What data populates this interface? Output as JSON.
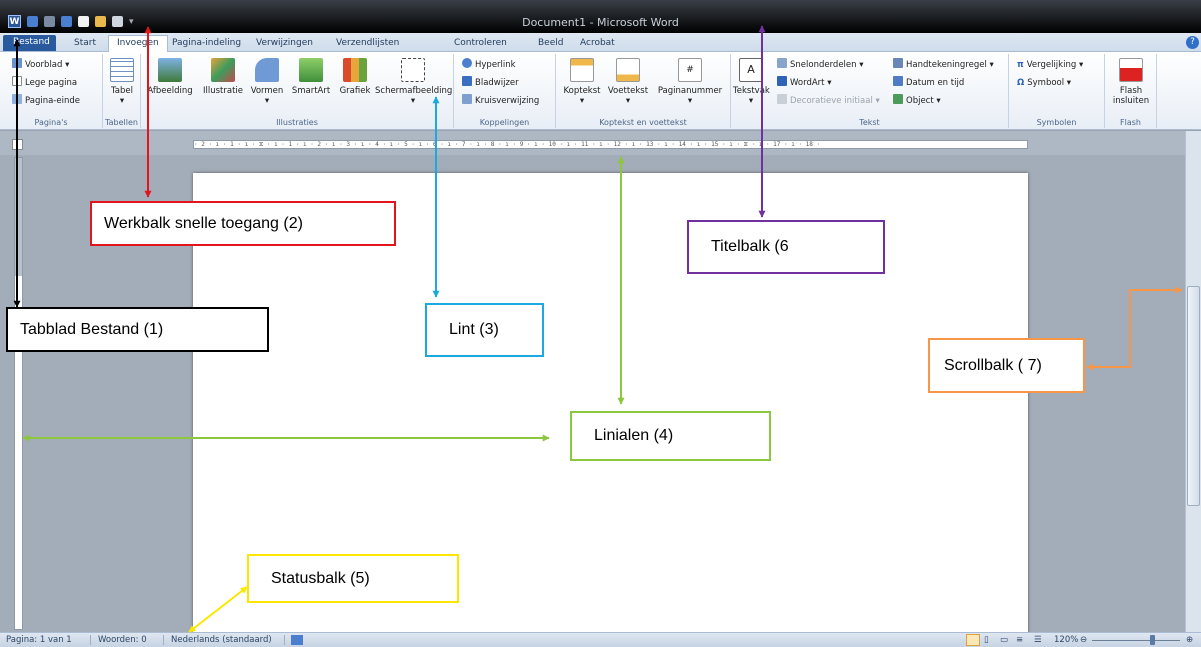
{
  "titlebar": {
    "document_title": "Document1 - Microsoft Word"
  },
  "quick_access": {
    "icons": [
      "word-logo",
      "save-icon",
      "undo-icon",
      "redo-icon",
      "new-doc-icon",
      "open-icon",
      "print-icon"
    ]
  },
  "tabs": {
    "file": "Bestand",
    "items": [
      "Start",
      "Invoegen",
      "Pagina-indeling",
      "Verwijzingen",
      "Verzendlijsten",
      "Controleren",
      "Beeld",
      "Acrobat"
    ],
    "active": "Invoegen"
  },
  "ribbon": {
    "paginas": {
      "label": "Pagina's",
      "items": [
        "Voorblad",
        "Lege pagina",
        "Pagina-einde"
      ]
    },
    "tabellen": {
      "label": "Tabellen",
      "button": "Tabel"
    },
    "illustraties": {
      "label": "Illustraties",
      "buttons": [
        "Afbeelding",
        "Illustratie",
        "Vormen",
        "SmartArt",
        "Grafiek",
        "Schermafbeelding"
      ]
    },
    "koppelingen": {
      "label": "Koppelingen",
      "items": [
        "Hyperlink",
        "Bladwijzer",
        "Kruisverwijzing"
      ]
    },
    "koptekst": {
      "label": "Koptekst en voettekst",
      "buttons": [
        "Koptekst",
        "Voettekst",
        "Paginanummer"
      ]
    },
    "tekst": {
      "label": "Tekst",
      "button": "Tekstvak",
      "items": [
        "Snelonderdelen",
        "WordArt",
        "Decoratieve initiaal",
        "Handtekeningregel",
        "Datum en tijd",
        "Object"
      ]
    },
    "symbolen": {
      "label": "Symbolen",
      "items": [
        "Vergelijking",
        "Symbool"
      ]
    },
    "flash": {
      "label": "Flash",
      "button_line1": "Flash",
      "button_line2": "insluiten"
    }
  },
  "ruler": {
    "text": "· 2 · ı · 1 · ı · ⧖ · ı · 1 · ı · 2 · ı · 3 · ı · 4 · ı · 5 · ı · 6 · ı · 7 · ı · 8 · ı · 9 · ı · 10 · ı · 11 · ı · 12 · ı · 13 · ı · 14 · ı · 15 · ı · ⧖ · ı · 17 · ı · 18 ·"
  },
  "statusbar": {
    "page": "Pagina: 1 van 1",
    "words": "Woorden: 0",
    "language": "Nederlands (standaard)",
    "zoom": "120%"
  },
  "callouts": {
    "c1": "Tabblad Bestand (1)",
    "c2": "Werkbalk snelle toegang (2)",
    "c3": "Lint (3)",
    "c4": "Linialen (4)",
    "c5": "Statusbalk (5)",
    "c6": "Titelbalk (6",
    "c7": "Scrollbalk ( 7)"
  },
  "colors": {
    "c1": "#000000",
    "c2": "#e3141b",
    "c3": "#1aa9e0",
    "c4": "#8dc63f",
    "c5": "#ffe600",
    "c6": "#7030a0",
    "c7": "#f79646"
  }
}
